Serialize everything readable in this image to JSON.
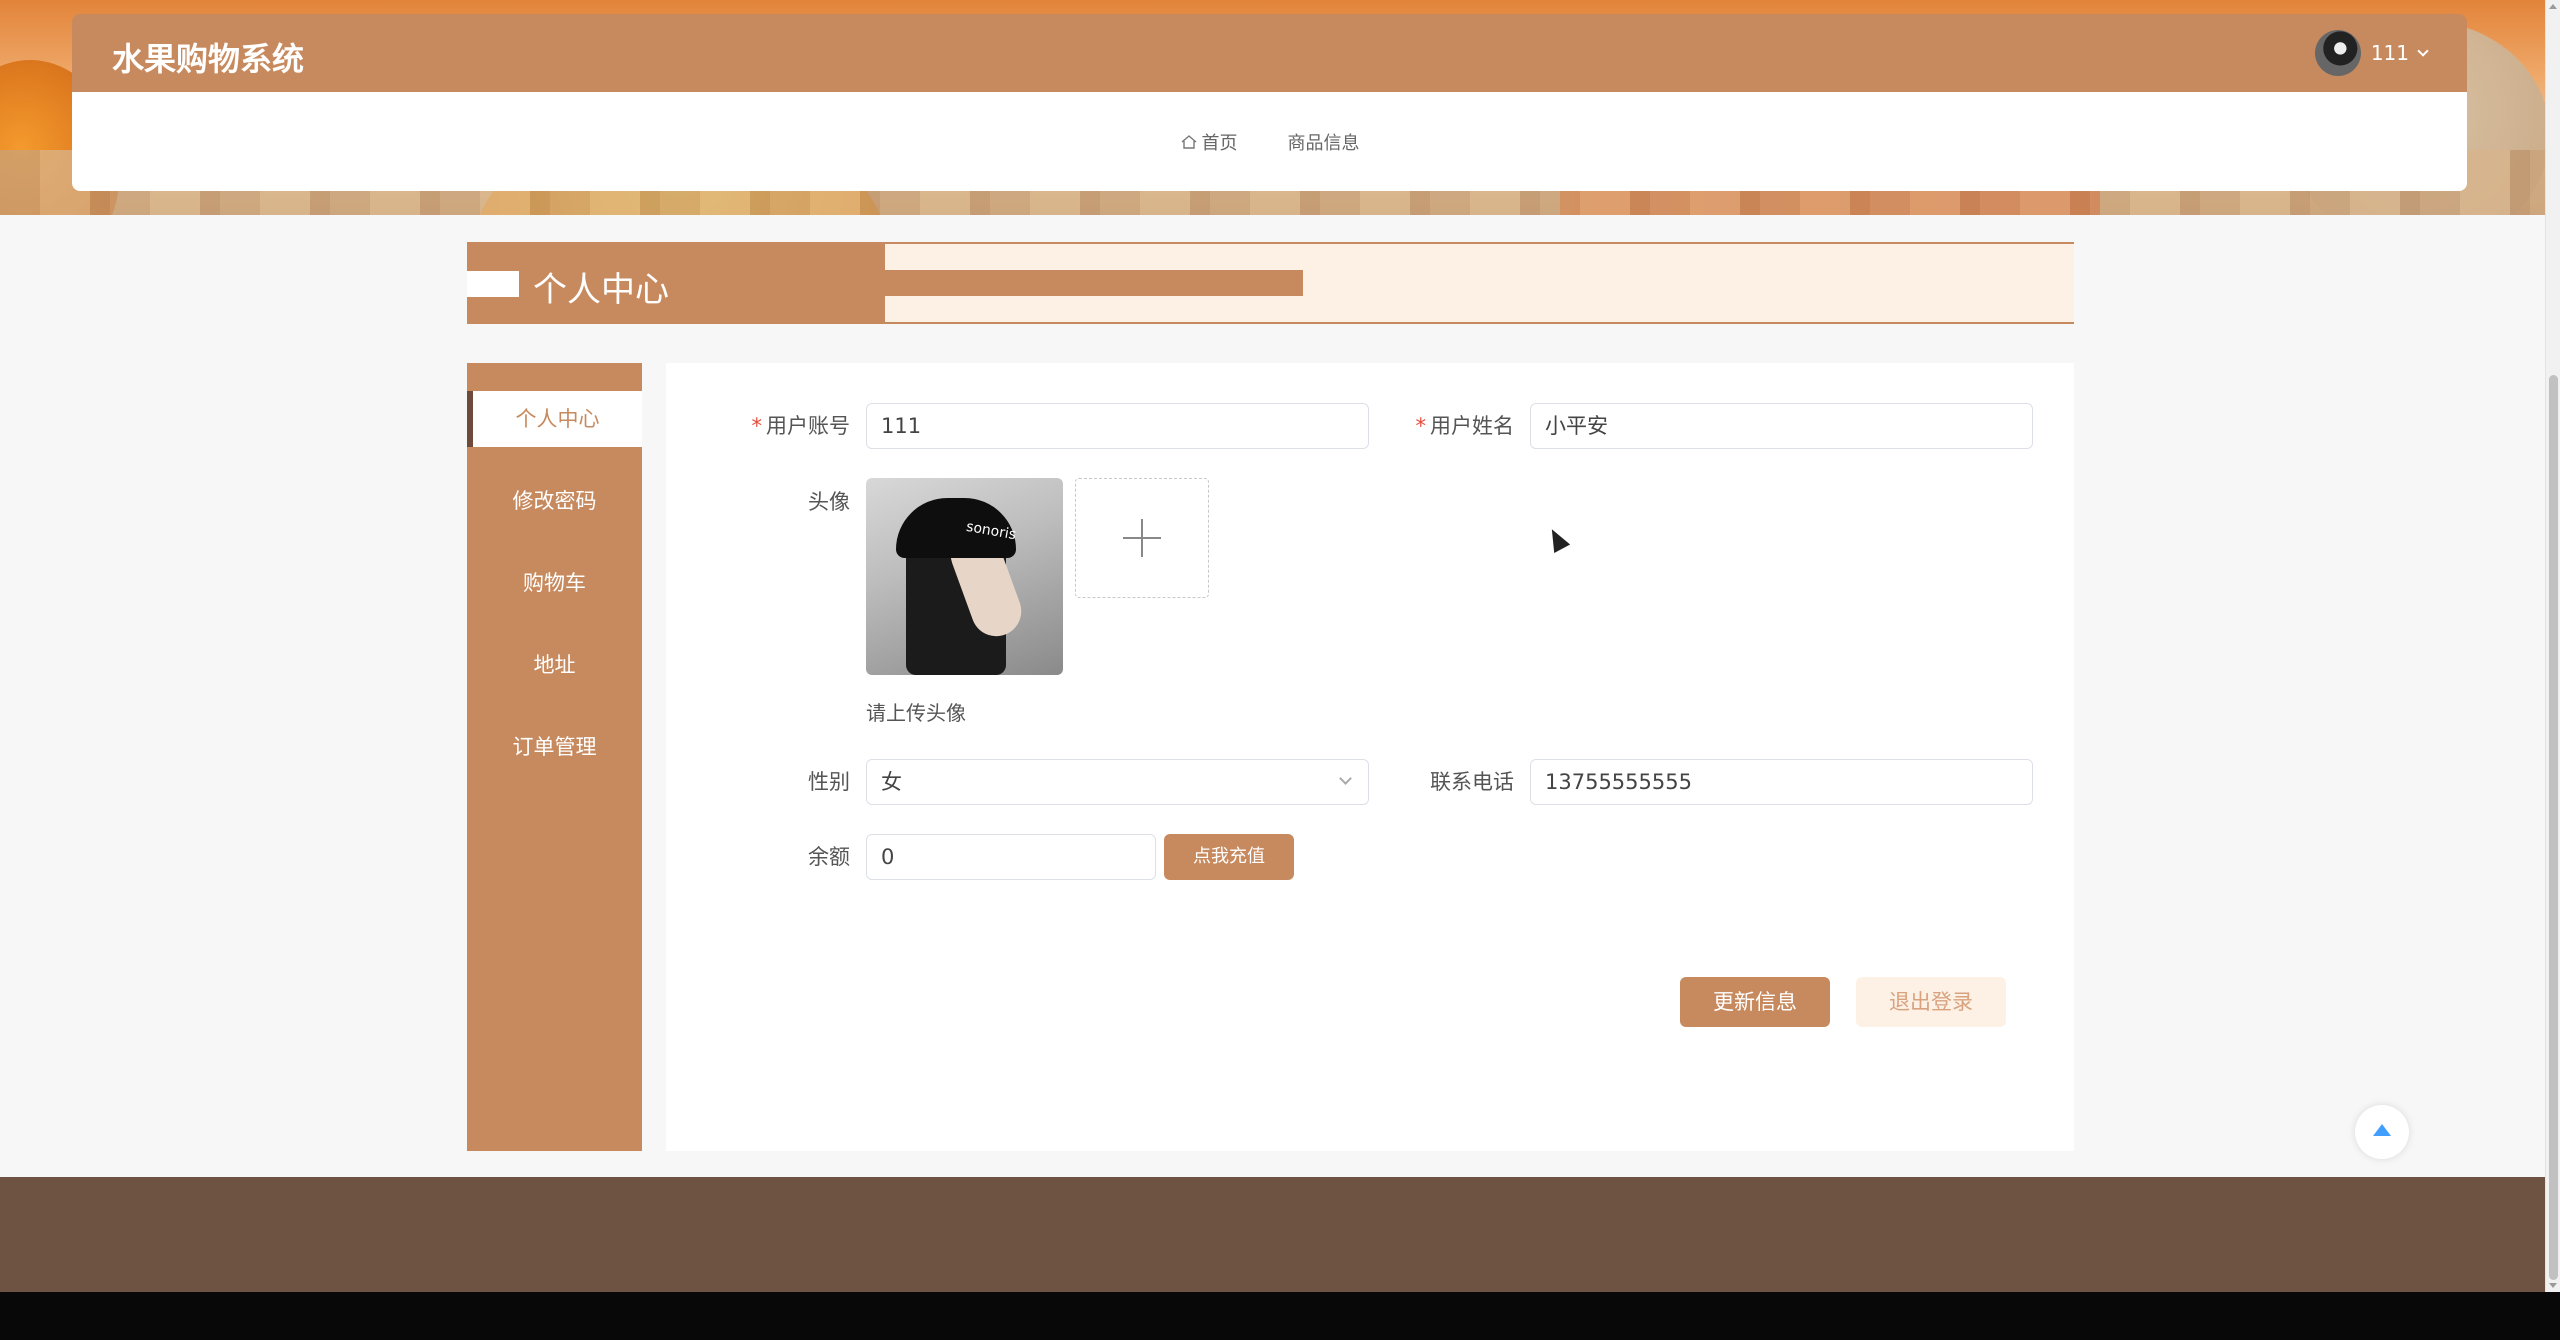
{
  "header": {
    "title": "水果购物系统",
    "username": "111"
  },
  "nav": {
    "items": [
      {
        "label": "首页",
        "icon": "home-icon"
      },
      {
        "label": "商品信息"
      }
    ]
  },
  "page_title": "个人中心",
  "sidebar": {
    "items": [
      {
        "label": "个人中心",
        "active": true
      },
      {
        "label": "修改密码"
      },
      {
        "label": "购物车"
      },
      {
        "label": "地址"
      },
      {
        "label": "订单管理"
      }
    ]
  },
  "form": {
    "account_label": "用户账号",
    "account_value": "111",
    "name_label": "用户姓名",
    "name_value": "小平安",
    "avatar_label": "头像",
    "avatar_hint": "请上传头像",
    "avatar_cap_text": "sonoris",
    "gender_label": "性别",
    "gender_value": "女",
    "phone_label": "联系电话",
    "phone_value": "13755555555",
    "balance_label": "余额",
    "balance_value": "0",
    "recharge_button": "点我充值",
    "update_button": "更新信息",
    "logout_button": "退出登录",
    "required_mark": "*"
  },
  "colors": {
    "brand": "#c78a5f",
    "brand_light": "#fdf1e6",
    "footer": "#6e5242",
    "accent_blue": "#409eff"
  }
}
